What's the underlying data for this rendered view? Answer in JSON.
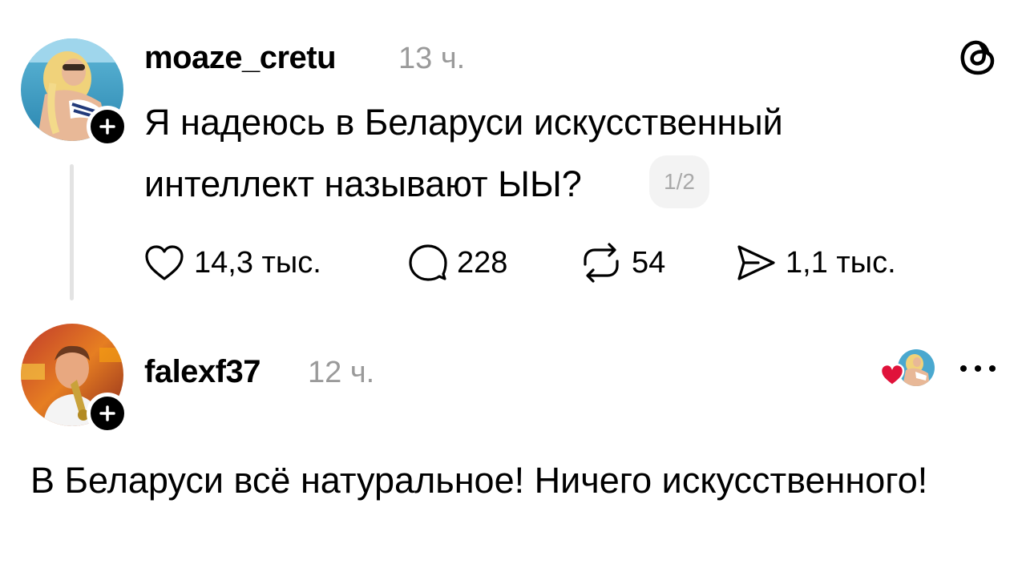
{
  "post1": {
    "username": "moaze_cretu",
    "time": "13 ч.",
    "text_line1": "Я надеюсь в Беларуси искусственный",
    "text_line2": "интеллект называют ЫЫ?",
    "page_indicator": "1/2",
    "actions": {
      "likes": "14,3 тыс.",
      "comments": "228",
      "reposts": "54",
      "shares": "1,1 тыс."
    }
  },
  "post2": {
    "username": "falexf37",
    "time": "12 ч.",
    "text": "В Беларуси всё натуральное! Ничего искусственного!"
  },
  "icons": {
    "brand": "threads-logo-icon",
    "like": "heart-outline-icon",
    "comment": "comment-bubble-icon",
    "repost": "repost-arrows-icon",
    "share": "share-arrow-icon",
    "liked_by": "red-heart-icon",
    "follow": "plus-icon",
    "menu": "more-dots-icon"
  },
  "colors": {
    "text": "#000000",
    "muted": "#9a9a9a",
    "liked_heart": "#e0123a",
    "thread_line": "#e3e3e3"
  }
}
